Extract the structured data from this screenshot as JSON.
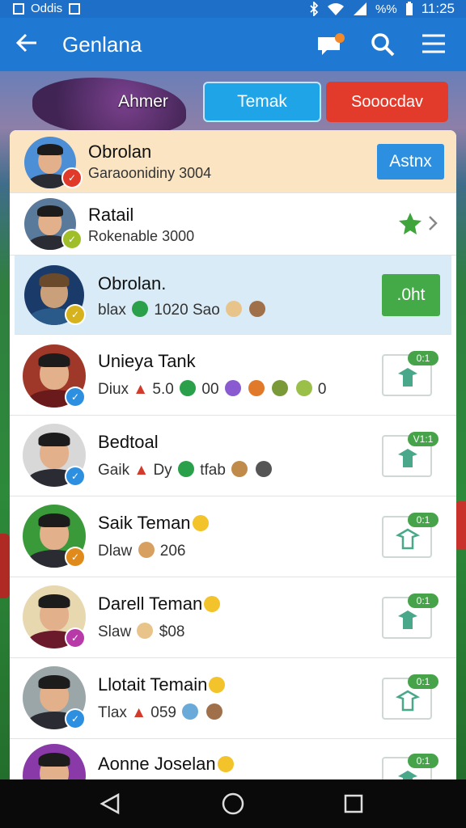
{
  "status_bar": {
    "left_text": "Oddis",
    "battery_text": "%%",
    "time": "11:25"
  },
  "app_bar": {
    "title": "Genlana"
  },
  "tabs": [
    {
      "label": "Ahmer"
    },
    {
      "label": "Temak"
    },
    {
      "label": "Sooocdav"
    }
  ],
  "rows": [
    {
      "name": "Obrolan",
      "subtitle": "Garaoonidiny 3004",
      "action": "Astnx",
      "badge_color": "#e03a2a"
    },
    {
      "name": "Ratail",
      "subtitle": "Rokenable 3000",
      "badge_color": "#9fbe2a"
    },
    {
      "name": "Obrolan.",
      "subtitle": "blax",
      "subtitle_extra": "1020 Sao",
      "action": ".0ht",
      "badge_color": "#d6b21c"
    },
    {
      "name": "Unieya Tank",
      "subtitle": "Diux",
      "subtitle_extra": "5.0",
      "subtitle_extra2": "00",
      "tail": "0",
      "tag": "0:1",
      "badge_color": "#2d8fe0"
    },
    {
      "name": "Bedtoal",
      "subtitle": "Gaik",
      "subtitle_extra": "Dy",
      "subtitle_extra2": "tfab",
      "tag": "V1:1",
      "badge_color": "#2d8fe0"
    },
    {
      "name": "Saik Teman",
      "subtitle": "Dlaw",
      "subtitle_extra": "206",
      "tag": "0:1",
      "badge_color": "#e08a1c"
    },
    {
      "name": "Darell Teman",
      "subtitle": "Slaw",
      "subtitle_extra": "$08",
      "tag": "0:1",
      "badge_color": "#b83aa8"
    },
    {
      "name": "Llotait Temain",
      "subtitle": "Tlax",
      "subtitle_extra": "059",
      "tag": "0:1",
      "badge_color": "#2d8fe0"
    },
    {
      "name": "Aonne Joselan",
      "tag": "0:1",
      "badge_color": "#2d8fe0"
    }
  ]
}
